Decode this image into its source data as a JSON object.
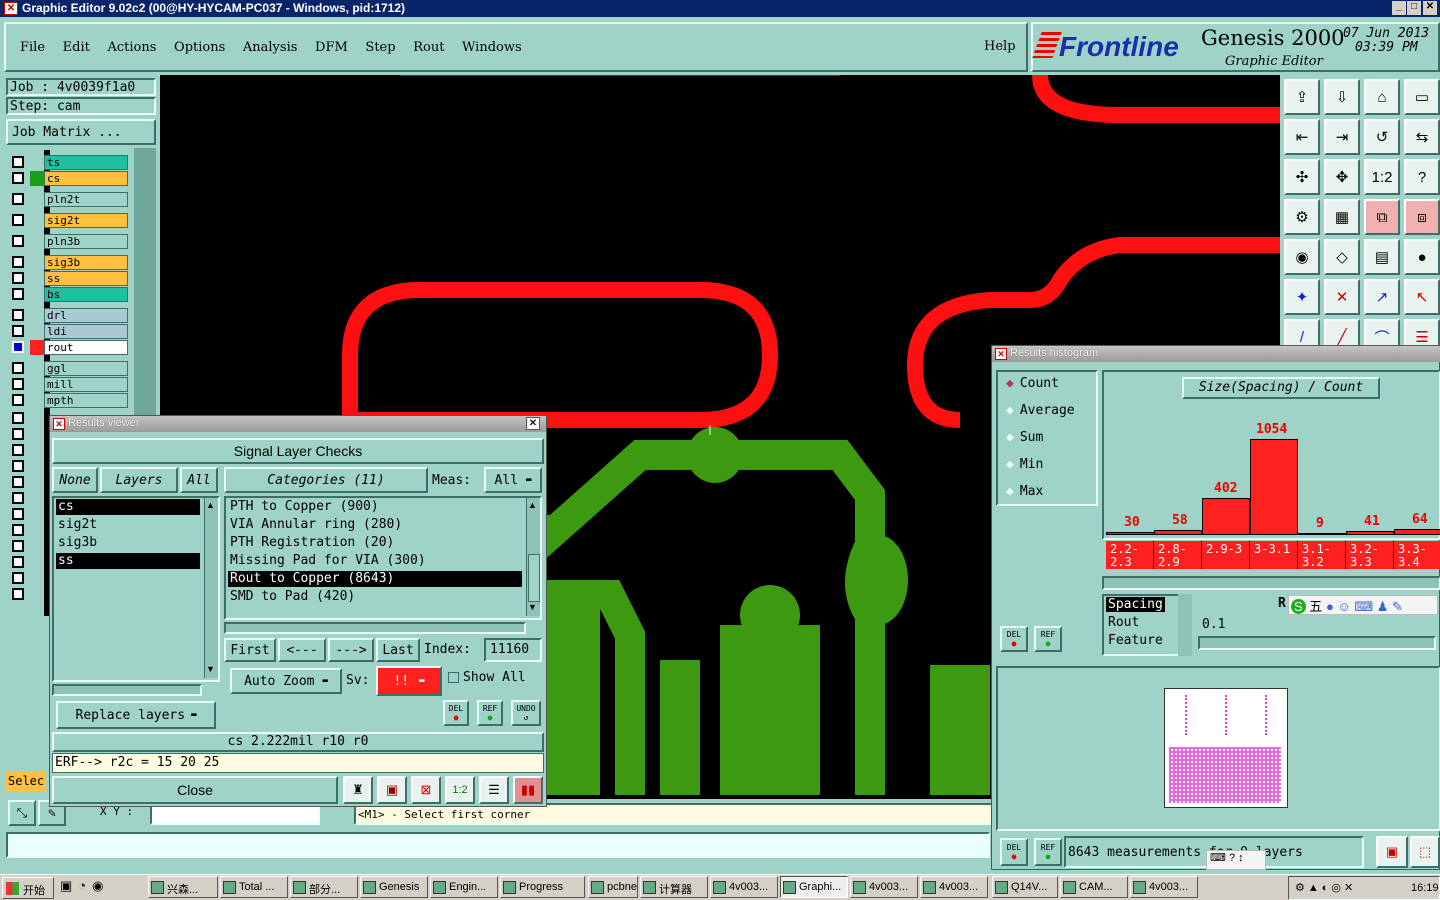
{
  "window": {
    "title": "Graphic Editor 9.02c2 (00@HY-HYCAM-PC037 - Windows, pid:1712)"
  },
  "menu": [
    "File",
    "Edit",
    "Actions",
    "Options",
    "Analysis",
    "DFM",
    "Step",
    "Rout",
    "Windows"
  ],
  "help": "Help",
  "brand": {
    "logo": "Frontline",
    "product": "Genesis 2000",
    "sub": "Graphic Editor",
    "date": "07 Jun 2013",
    "time": "03:39 PM"
  },
  "job": {
    "job_label": "Job : 4v0039f1a0",
    "step_label": "Step: cam",
    "matrix_btn": "Job Matrix ..."
  },
  "layers": [
    {
      "name": "ts",
      "color": "#1fbf9f"
    },
    {
      "name": "cs",
      "color": "#ffc040"
    },
    {
      "name": "pln2t",
      "color": "#9fd3c7"
    },
    {
      "name": "sig2t",
      "color": "#ffc040"
    },
    {
      "name": "pln3b",
      "color": "#9fd3c7"
    },
    {
      "name": "sig3b",
      "color": "#ffc040"
    },
    {
      "name": "ss",
      "color": "#ffc040"
    },
    {
      "name": "bs",
      "color": "#1fbf9f"
    },
    {
      "name": "drl",
      "color": "#a9c9d4"
    },
    {
      "name": "ldi",
      "color": "#a9c9d4"
    },
    {
      "name": "rout",
      "color": "#ffffff"
    },
    {
      "name": "ggl",
      "color": "#9fd3c7"
    },
    {
      "name": "mill",
      "color": "#9fd3c7"
    },
    {
      "name": "mpth",
      "color": "#9fd3c7"
    }
  ],
  "select_label": "Selec",
  "status": {
    "xy": "X Y :",
    "prompt": "<M1> - Select first corner"
  },
  "results_viewer": {
    "title": "Results viewer",
    "header": "Signal Layer Checks",
    "none_btn": "None",
    "layers_btn": "Layers",
    "all_btn": "All",
    "layer_list": [
      "cs",
      "sig2t",
      "sig3b",
      "ss"
    ],
    "categories_btn": "Categories (11)",
    "meas_label": "Meas:",
    "meas_value": "All",
    "categories": [
      "PTH to Copper (900)",
      "VIA Annular ring (280)",
      "PTH Registration (20)",
      "Missing Pad for VIA (300)",
      "Rout to Copper (8643)",
      "SMD to Pad (420)"
    ],
    "first": "First",
    "prev": "<---",
    "next": "--->",
    "last": "Last",
    "index_label": "Index:",
    "index_value": "11160",
    "auto_zoom": "Auto Zoom",
    "sv_label": "Sv:",
    "sv_value": "!!",
    "show_all": "Show All",
    "replace_layers": "Replace layers",
    "del": "DEL",
    "ref": "REF",
    "undo": "UNDO",
    "info": "cs 2.222mil  r10  r0",
    "erf": "ERF--> r2c = 15 20 25",
    "close": "Close"
  },
  "histogram": {
    "title": "Results histogram",
    "modes": [
      "Count",
      "Average",
      "Sum",
      "Min",
      "Max"
    ],
    "chart_title": "Size(Spacing) / Count",
    "del": "DEL",
    "ref": "REF",
    "meas_list": [
      "Spacing",
      "Rout",
      "Feature"
    ],
    "r_label": "R",
    "value": "0.1",
    "footer": "8643 measurements for 0 layers",
    "ime": "五"
  },
  "chart_data": {
    "type": "bar",
    "title": "Size(Spacing) / Count",
    "categories": [
      "2.2-2.3",
      "2.8-2.9",
      "2.9-3",
      "3-3.1",
      "3.1-3.2",
      "3.2-3.3",
      "3.3-3.4"
    ],
    "values": [
      30,
      58,
      402,
      1054,
      9,
      41,
      64
    ],
    "ylim": [
      0,
      1100
    ],
    "bar_color": "#ff2020",
    "grid": false,
    "xlabel": "",
    "ylabel": ""
  },
  "taskbar": {
    "start": "开始",
    "items": [
      "兴森...",
      "Total ...",
      "部分...",
      "Genesis",
      "Engin...",
      "Progress",
      "pcbne...",
      "计算器",
      "4v003...",
      "Graphi...",
      "4v003...",
      "4v003...",
      "Q14V...",
      "CAM...",
      "4v003..."
    ],
    "clock": "16:19"
  }
}
